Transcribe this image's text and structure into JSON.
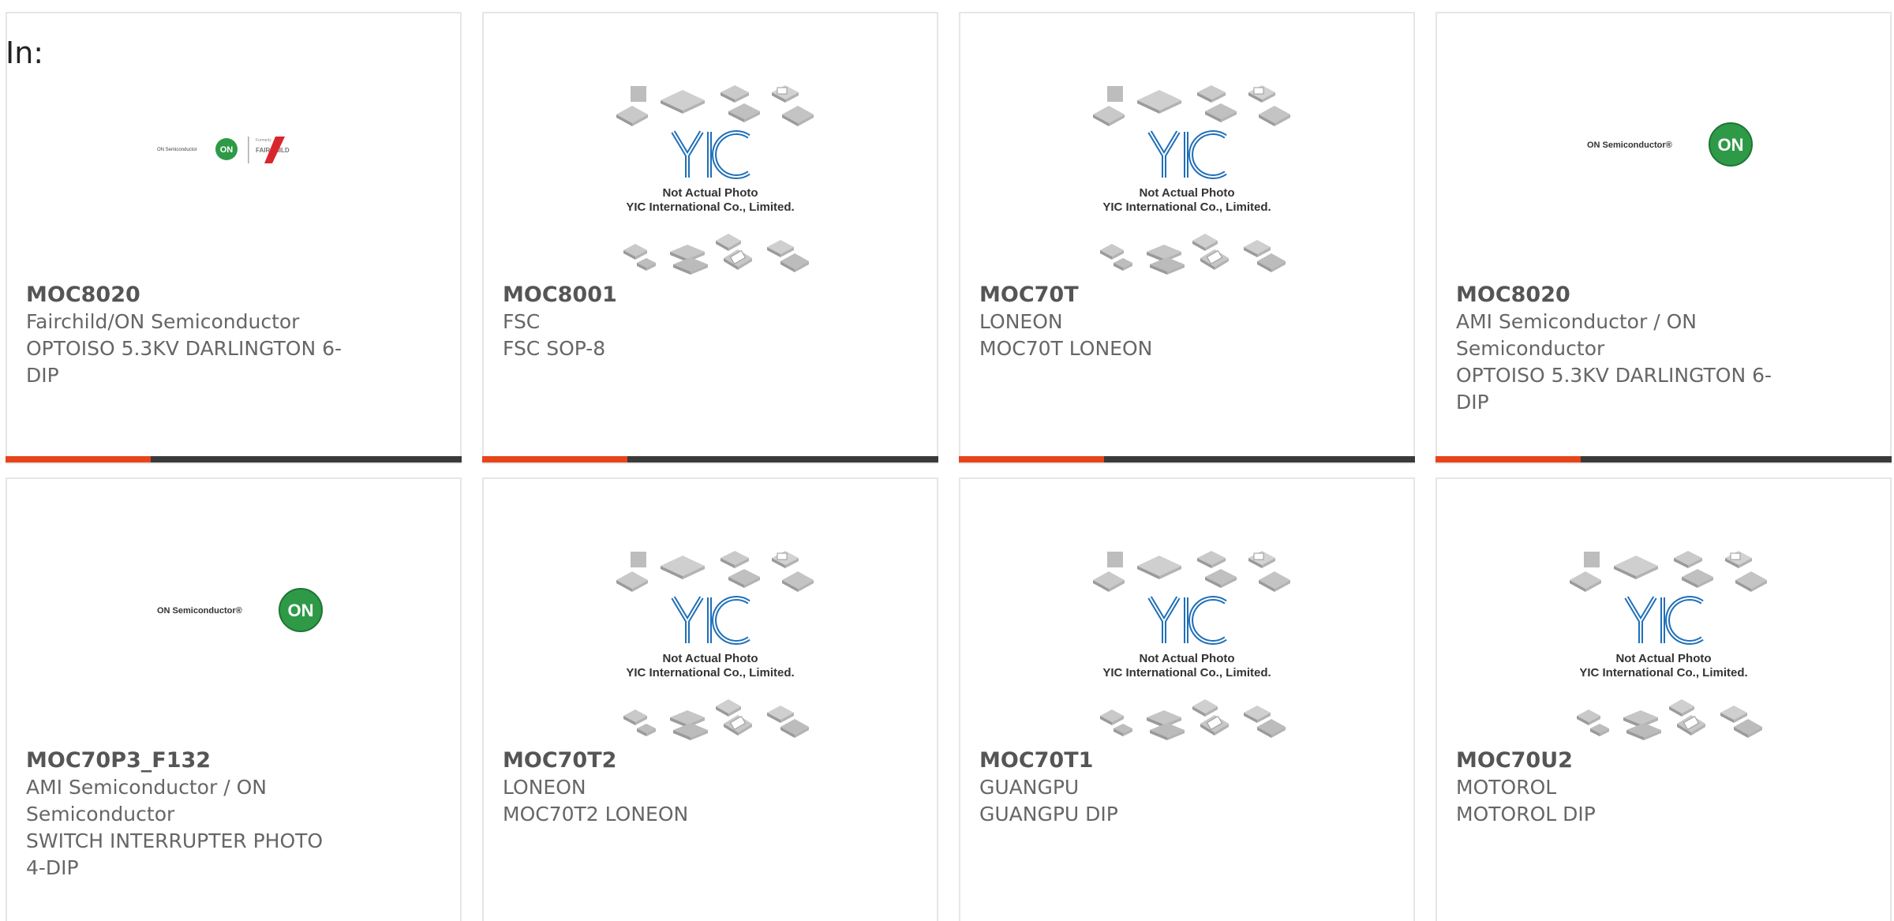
{
  "header": {
    "in_label": "In:"
  },
  "placeholder": {
    "line1": "Not Actual Photo",
    "line2": "YIC International Co., Limited.",
    "logo": "YIC"
  },
  "logos": {
    "onsemi_text": "ON Semiconductor",
    "on_badge": "ON",
    "fairchild_formerly": "Formerly",
    "fairchild_name": "FAIRCHILD"
  },
  "colors": {
    "accent_orange": "#e8441a",
    "bar_dark": "#3a3a3a",
    "on_green": "#2e9a48",
    "yic_blue": "#1f6fb8"
  },
  "products": [
    {
      "part": "MOC8020",
      "manufacturer": "Fairchild/ON Semiconductor",
      "description_lines": [
        "OPTOISO 5.3KV DARLINGTON 6-",
        "DIP"
      ],
      "image": "onsemi-fairchild-logo"
    },
    {
      "part": "MOC8001",
      "manufacturer": "FSC",
      "description_lines": [
        "FSC SOP-8"
      ],
      "image": "yic-placeholder"
    },
    {
      "part": "MOC70T",
      "manufacturer": "LONEON",
      "description_lines": [
        "MOC70T LONEON"
      ],
      "image": "yic-placeholder"
    },
    {
      "part": "MOC8020",
      "manufacturer_lines": [
        "AMI Semiconductor / ON",
        "Semiconductor"
      ],
      "description_lines": [
        "OPTOISO 5.3KV DARLINGTON 6-",
        "DIP"
      ],
      "image": "onsemi-logo"
    },
    {
      "part": "MOC70P3_F132",
      "manufacturer_lines": [
        "AMI Semiconductor / ON",
        "Semiconductor"
      ],
      "description_lines": [
        "SWITCH INTERRUPTER PHOTO",
        "4-DIP"
      ],
      "image": "onsemi-logo"
    },
    {
      "part": "MOC70T2",
      "manufacturer": "LONEON",
      "description_lines": [
        "MOC70T2 LONEON"
      ],
      "image": "yic-placeholder"
    },
    {
      "part": "MOC70T1",
      "manufacturer": "GUANGPU",
      "description_lines": [
        "GUANGPU DIP"
      ],
      "image": "yic-placeholder"
    },
    {
      "part": "MOC70U2",
      "manufacturer": "MOTOROL",
      "description_lines": [
        "MOTOROL DIP"
      ],
      "image": "yic-placeholder"
    }
  ]
}
